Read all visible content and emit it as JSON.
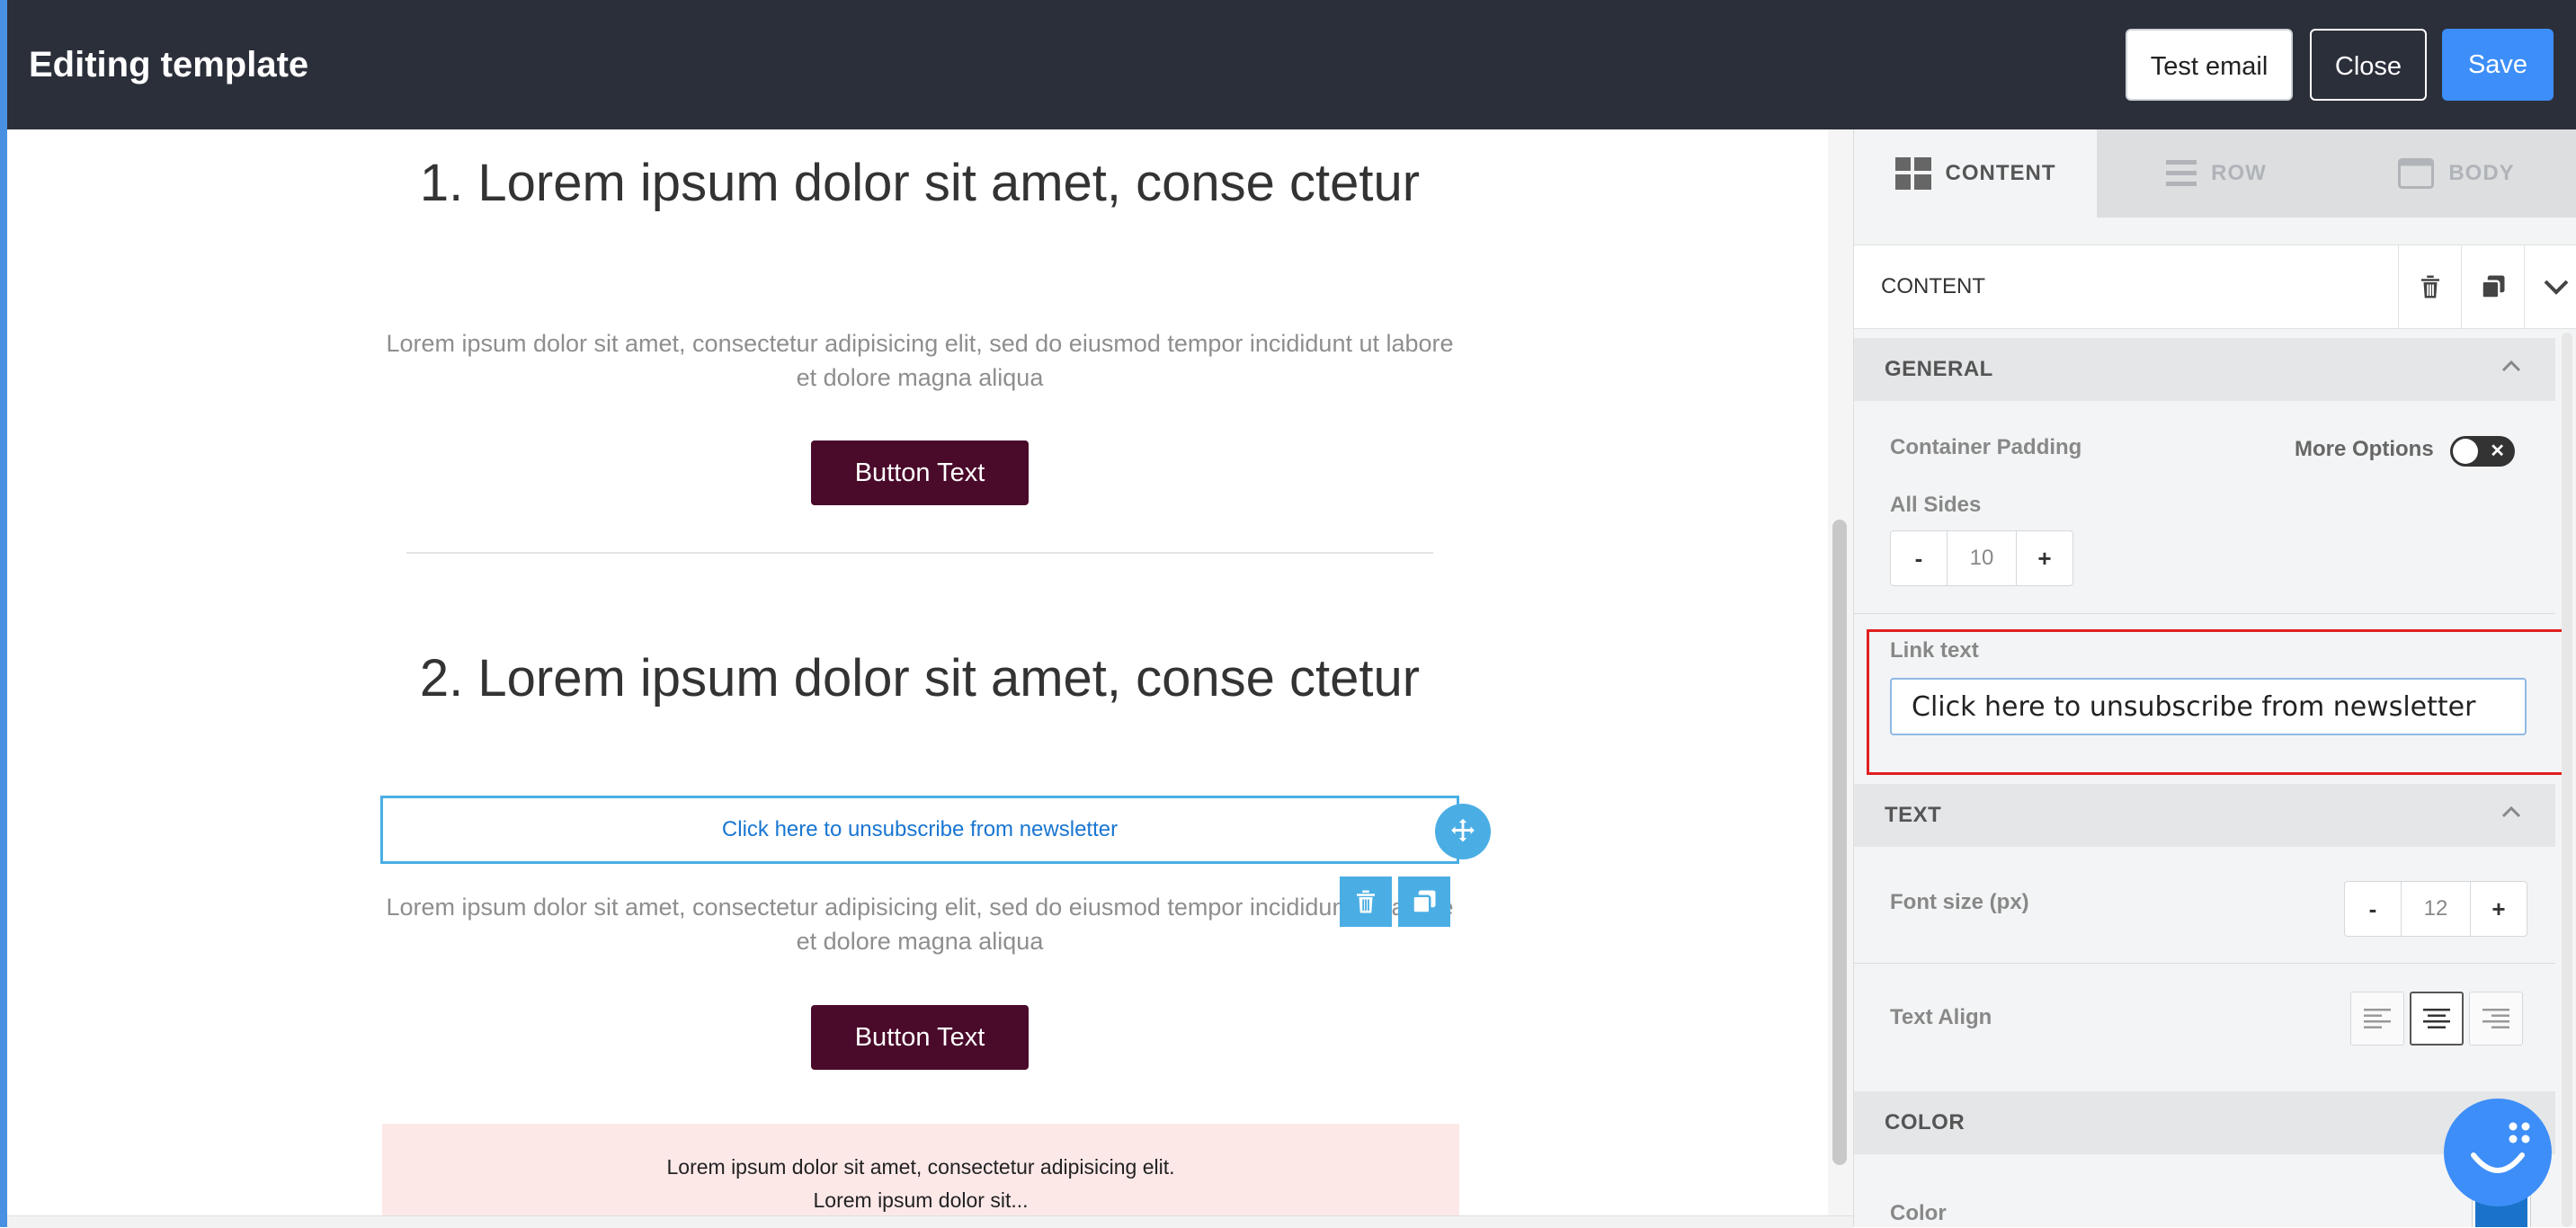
{
  "header": {
    "title": "Editing template",
    "test_email_label": "Test email",
    "close_label": "Close",
    "save_label": "Save"
  },
  "canvas": {
    "section1": {
      "heading": "1. Lorem ipsum dolor sit amet, conse ctetur",
      "paragraph": "Lorem ipsum dolor sit amet, consectetur adipisicing elit, sed do eiusmod tempor incididunt ut labore et dolore magna aliqua",
      "button": "Button Text"
    },
    "section2": {
      "heading": "2. Lorem ipsum dolor sit amet, conse ctetur",
      "link_text": "Click here to unsubscribe from newsletter",
      "paragraph": "Lorem ipsum dolor sit amet, consectetur adipisicing elit, sed do eiusmod tempor incididunt ut labore et dolore magna aliqua",
      "button": "Button Text"
    },
    "footer": {
      "line1": "Lorem ipsum dolor sit amet, consectetur adipisicing elit.",
      "line2": "Lorem ipsum dolor sit..."
    }
  },
  "panel": {
    "tabs": [
      {
        "label": "CONTENT",
        "icon": "grid-icon",
        "active": true
      },
      {
        "label": "ROW",
        "icon": "rows-icon",
        "active": false
      },
      {
        "label": "BODY",
        "icon": "body-icon",
        "active": false
      }
    ],
    "content_header": "CONTENT",
    "general": {
      "title": "GENERAL",
      "container_padding_label": "Container Padding",
      "more_options_label": "More Options",
      "all_sides_label": "All Sides",
      "padding_value": "10",
      "minus": "-",
      "plus": "+"
    },
    "link": {
      "label": "Link text",
      "value": "Click here to unsubscribe from newsletter"
    },
    "text": {
      "title": "TEXT",
      "font_size_label": "Font size (px)",
      "font_size_value": "12",
      "minus": "-",
      "plus": "+",
      "text_align_label": "Text Align",
      "align_options": [
        "left",
        "center",
        "right"
      ],
      "align_selected": "center"
    },
    "color": {
      "title": "COLOR",
      "color_label": "Color",
      "swatch": "#1a73c8"
    }
  },
  "colors": {
    "topbar": "#2b2f3a",
    "accent": "#3d8ef8",
    "cta_button": "#4a0a2a",
    "selection": "#4aaee4",
    "highlight": "#e02020"
  }
}
